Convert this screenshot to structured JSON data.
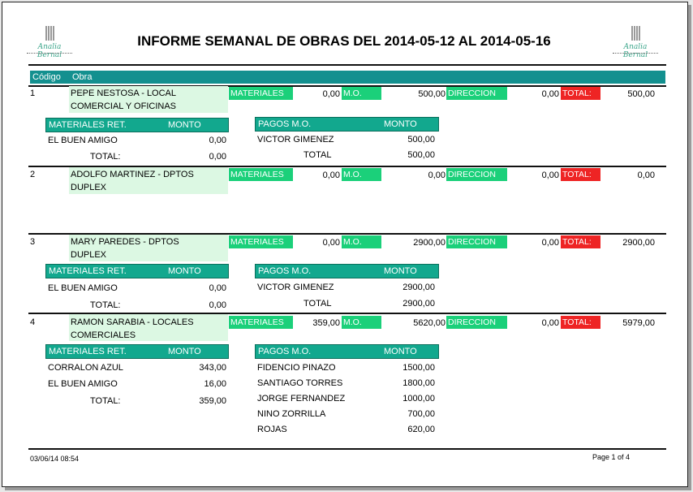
{
  "brand": {
    "logo_text": "Analia Bernal"
  },
  "title": "INFORME SEMANAL DE OBRAS DEL 2014-05-12 AL 2014-05-16",
  "columns": {
    "codigo": "Código",
    "obra": "Obra"
  },
  "labels": {
    "materiales": "MATERIALES",
    "mo": "M.O.",
    "direccion": "DIRECCION",
    "total": "TOTAL:",
    "materiales_ret": "MATERIALES RET.",
    "monto": "MONTO",
    "pagos_mo": "PAGOS M.O.",
    "total_sub": "TOTAL:",
    "total_pagos": "TOTAL"
  },
  "rows": [
    {
      "code": "1",
      "obra_line1": "PEPE NESTOSA - LOCAL",
      "obra_line2": "COMERCIAL Y OFICINAS",
      "materiales": "0,00",
      "mo": "500,00",
      "direccion": "0,00",
      "total": "500,00",
      "materiales_ret": [
        {
          "name": "EL BUEN AMIGO",
          "monto": "0,00"
        }
      ],
      "materiales_total": "0,00",
      "pagos": [
        {
          "name": "VICTOR GIMENEZ",
          "monto": "500,00"
        }
      ],
      "pagos_total": "500,00"
    },
    {
      "code": "2",
      "obra_line1": "ADOLFO MARTINEZ - DPTOS",
      "obra_line2": "DUPLEX",
      "materiales": "0,00",
      "mo": "0,00",
      "direccion": "0,00",
      "total": "0,00"
    },
    {
      "code": "3",
      "obra_line1": "MARY PAREDES - DPTOS",
      "obra_line2": "DUPLEX",
      "materiales": "0,00",
      "mo": "2900,00",
      "direccion": "0,00",
      "total": "2900,00",
      "materiales_ret": [
        {
          "name": "EL BUEN AMIGO",
          "monto": "0,00"
        }
      ],
      "materiales_total": "0,00",
      "pagos": [
        {
          "name": "VICTOR GIMENEZ",
          "monto": "2900,00"
        }
      ],
      "pagos_total": "2900,00"
    },
    {
      "code": "4",
      "obra_line1": "RAMON SARABIA - LOCALES",
      "obra_line2": "COMERCIALES",
      "materiales": "359,00",
      "mo": "5620,00",
      "direccion": "0,00",
      "total": "5979,00",
      "materiales_ret": [
        {
          "name": "CORRALON AZUL",
          "monto": "343,00"
        },
        {
          "name": "EL BUEN AMIGO",
          "monto": "16,00"
        }
      ],
      "materiales_total": "359,00",
      "pagos": [
        {
          "name": "FIDENCIO PINAZO",
          "monto": "1500,00"
        },
        {
          "name": "SANTIAGO TORRES",
          "monto": "1800,00"
        },
        {
          "name": "JORGE FERNANDEZ",
          "monto": "1000,00"
        },
        {
          "name": "NINO ZORRILLA",
          "monto": "700,00"
        },
        {
          "name": "ROJAS",
          "monto": "620,00"
        }
      ]
    }
  ],
  "footer": {
    "datetime": "03/06/14 08:54",
    "page": "Page 1 of  4"
  },
  "colors": {
    "teal_header": "#13908f",
    "green_tag": "#1bd07a",
    "red_tag": "#ee2424",
    "obra_bg": "#dcf8e3"
  }
}
